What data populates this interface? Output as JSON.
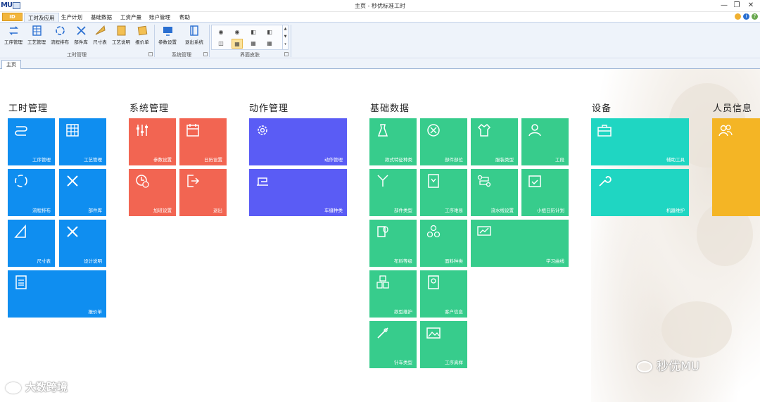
{
  "window": {
    "title": "主页 - 秒优标准工时",
    "app_logo": "MU",
    "controls": [
      "—",
      "❐",
      "✕"
    ]
  },
  "ribbon": {
    "file_tab": "ID",
    "tabs": [
      "工时及应用",
      "生产计划",
      "基础数据",
      "工资产量",
      "账户管理",
      "帮助"
    ],
    "active_tab": "工时及应用",
    "groups": [
      {
        "label": "工时管理",
        "buttons": [
          "工序管理",
          "工艺管理",
          "流程排布",
          "部件库",
          "尺寸表",
          "工艺说明",
          "报价单"
        ]
      },
      {
        "label": "系统管理",
        "buttons": [
          "参数设置",
          "退出系统"
        ]
      },
      {
        "label": "界面皮肤",
        "buttons": []
      }
    ]
  },
  "doc_tab": "主页",
  "sections": {
    "gongshi": {
      "title": "工时管理",
      "tiles": [
        "工序管理",
        "工艺管理",
        "流程排布",
        "部件库",
        "尺寸表",
        "设计说明",
        "报价单"
      ]
    },
    "xitong": {
      "title": "系统管理",
      "tiles": [
        "参数设置",
        "日历设置",
        "加班设置",
        "退出"
      ]
    },
    "dongzuo": {
      "title": "动作管理",
      "tiles": [
        "动作管理",
        "车缝种类"
      ]
    },
    "jichu": {
      "title": "基础数据",
      "tiles": [
        "款式特征种类",
        "部件部位",
        "服装类型",
        "工段",
        "部件类型",
        "工序难易",
        "流水线设置",
        "小组日历计划",
        "布料等级",
        "面料种类",
        "学习曲线",
        "款型维护",
        "客户信息",
        "针车类型",
        "工序真样"
      ]
    },
    "shebei": {
      "title": "设备",
      "tiles": [
        "辅助工具",
        "机器维护"
      ]
    },
    "renyuan": {
      "title": "人员信息",
      "tiles": [
        ""
      ]
    }
  },
  "watermarks": {
    "left": "大数跨境",
    "right": "秒优MU"
  },
  "colors": {
    "blue": "#0f8ef0",
    "red": "#f26552",
    "purple": "#5a5cf5",
    "green": "#37cc8c",
    "teal": "#1fd6c2",
    "yellow": "#f4b525"
  }
}
